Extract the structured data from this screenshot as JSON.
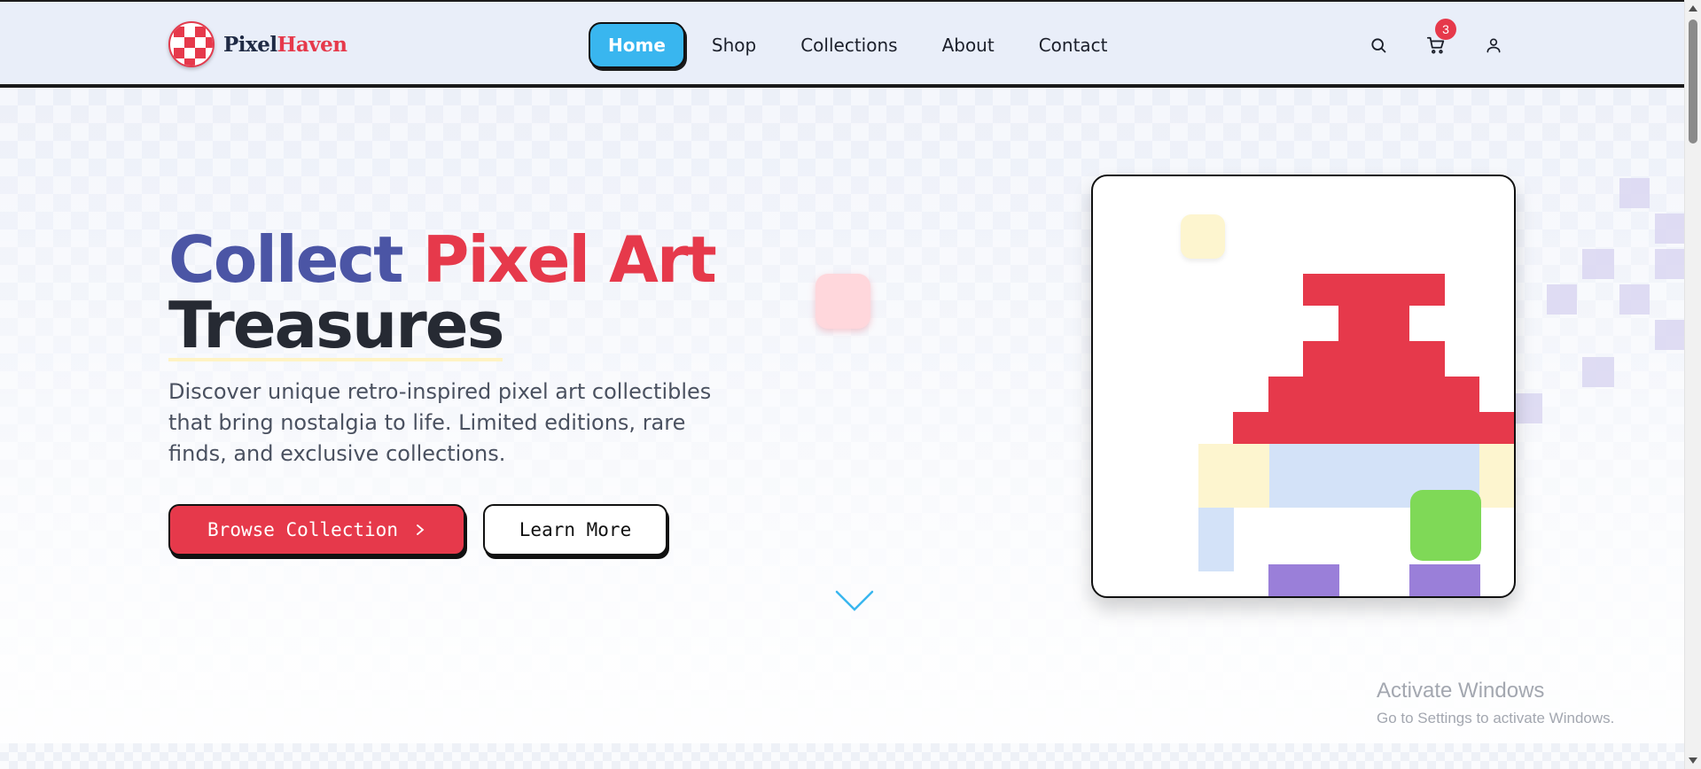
{
  "brand": {
    "part1": "Pixel",
    "part2": "Haven"
  },
  "nav": {
    "items": [
      {
        "label": "Home",
        "active": true
      },
      {
        "label": "Shop"
      },
      {
        "label": "Collections"
      },
      {
        "label": "About"
      },
      {
        "label": "Contact"
      }
    ]
  },
  "header_icons": {
    "search": "search-icon",
    "cart": "cart-icon",
    "user": "user-icon",
    "cart_count": "3"
  },
  "hero": {
    "title_part1": "Collect",
    "title_part2": "Pixel Art",
    "title_part3": "Treasures",
    "description": "Discover unique retro-inspired pixel art collectibles that bring nostalgia to life. Limited editions, rare finds, and exclusive collections.",
    "primary_button": "Browse Collection",
    "primary_button_icon": "chevron-right-icon",
    "secondary_button": "Learn More",
    "scroll_icon": "chevron-down-icon"
  },
  "colors": {
    "accent_blue": "#39b6ef",
    "brand_red": "#e6394b",
    "title_blue": "#4b55a5",
    "pixel_yellow": "#fdf5cf",
    "pixel_lightblue": "#d3e2f8",
    "pixel_green": "#7fd957",
    "pixel_purple": "#9a7fd9"
  },
  "watermark": {
    "line1": "Activate Windows",
    "line2": "Go to Settings to activate Windows."
  }
}
